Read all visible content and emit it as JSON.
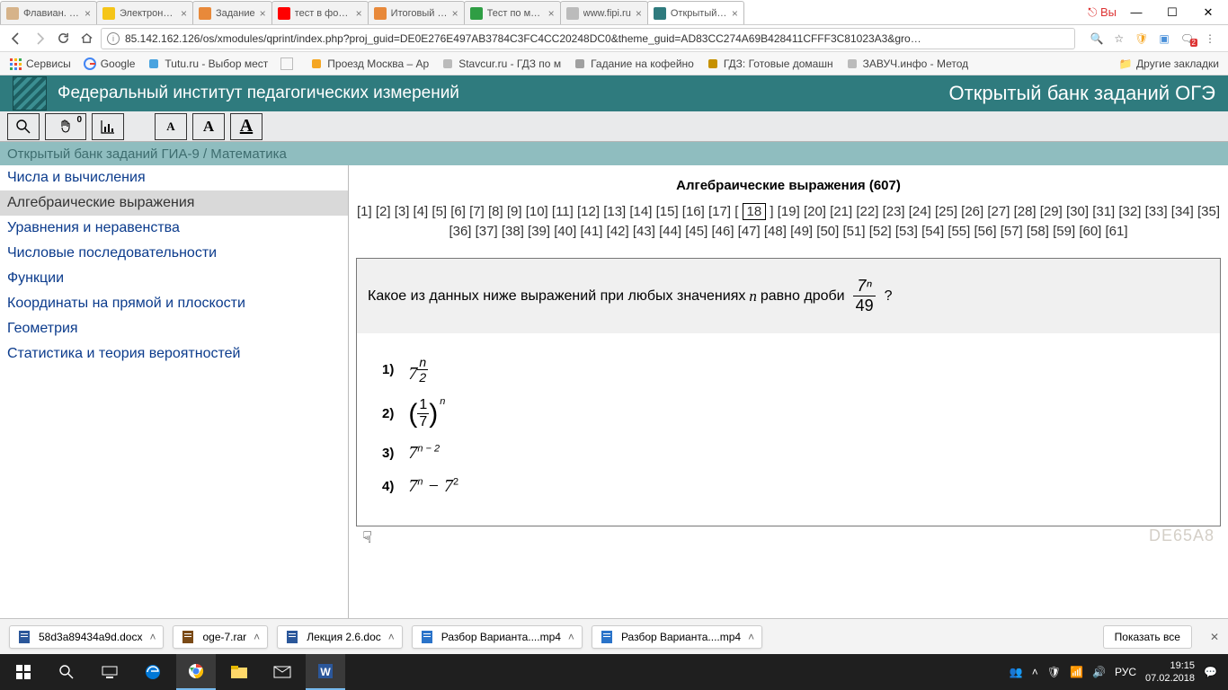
{
  "browser": {
    "tabs": [
      {
        "title": "Флавиан. Арм",
        "favcolor": "#d6b38a"
      },
      {
        "title": "Электронная",
        "favcolor": "#f5c518"
      },
      {
        "title": "Задание",
        "favcolor": "#e8893a"
      },
      {
        "title": "тест в формат",
        "favcolor": "#ff0000"
      },
      {
        "title": "Итоговый тес",
        "favcolor": "#e8893a"
      },
      {
        "title": "Тест по мате",
        "favcolor": "#2f9e44"
      },
      {
        "title": "www.fipi.ru",
        "favcolor": "#bbbbbb"
      },
      {
        "title": "Открытый бан",
        "favcolor": "#2f7b7e",
        "active": true
      }
    ],
    "user_badge": "Вы",
    "address": "85.142.162.126/os/xmodules/qprint/index.php?proj_guid=DE0E276E497AB3784C3FC4CC20248DC0&theme_guid=AD83CC274A69B428411CFFF3C81023A3&gro…",
    "bookmarks": {
      "apps": "Сервисы",
      "items": [
        {
          "label": "Google",
          "color": "#4285F4"
        },
        {
          "label": "Tutu.ru - Выбор мест",
          "color": "#4aa3df"
        },
        {
          "label": "",
          "color": "#bbbbbb",
          "blank": true
        },
        {
          "label": "Проезд Москва – Ар",
          "color": "#f5a623"
        },
        {
          "label": "Stavcur.ru - ГДЗ по м",
          "color": "#bbbbbb"
        },
        {
          "label": "Гадание на кофейно",
          "color": "#a0a0a0"
        },
        {
          "label": "ГДЗ: Готовые домашн",
          "color": "#c69100"
        },
        {
          "label": "ЗАВУЧ.инфо - Метод",
          "color": "#bbbbbb"
        }
      ],
      "other": "Другие закладки"
    }
  },
  "site": {
    "left_title": "Федеральный институт педагогических измерений",
    "right_title": "Открытый банк заданий ОГЭ",
    "breadcrumb": "Открытый банк заданий ГИА-9 / Математика"
  },
  "sidebar": {
    "items": [
      "Числа и вычисления",
      "Алгебраические выражения",
      "Уравнения и неравенства",
      "Числовые последовательности",
      "Функции",
      "Координаты на прямой и плоскости",
      "Геометрия",
      "Статистика и теория вероятностей"
    ],
    "selected_index": 1
  },
  "task": {
    "topic_title": "Алгебраические выражения (607)",
    "page_count": 61,
    "current_page": 18,
    "question_prefix": "Какое из данных ниже выражений при любых значениях ",
    "question_var": "n",
    "question_mid": " равно дроби ",
    "question_frac_top": "7ⁿ",
    "question_frac_bot": "49",
    "question_suffix": " ?",
    "options_numbers": [
      "1)",
      "2)",
      "3)",
      "4)"
    ],
    "code": "DE65A8"
  },
  "downloads": {
    "items": [
      {
        "name": "58d3a89434a9d.docx",
        "type": "docx"
      },
      {
        "name": "oge-7.rar",
        "type": "rar"
      },
      {
        "name": "Лекция 2.6.doc",
        "type": "doc"
      },
      {
        "name": "Разбор Варианта....mp4",
        "type": "mp4"
      },
      {
        "name": "Разбор Варианта....mp4",
        "type": "mp4"
      }
    ],
    "show_all": "Показать все"
  },
  "taskbar": {
    "lang": "РУС",
    "time": "19:15",
    "date": "07.02.2018"
  }
}
